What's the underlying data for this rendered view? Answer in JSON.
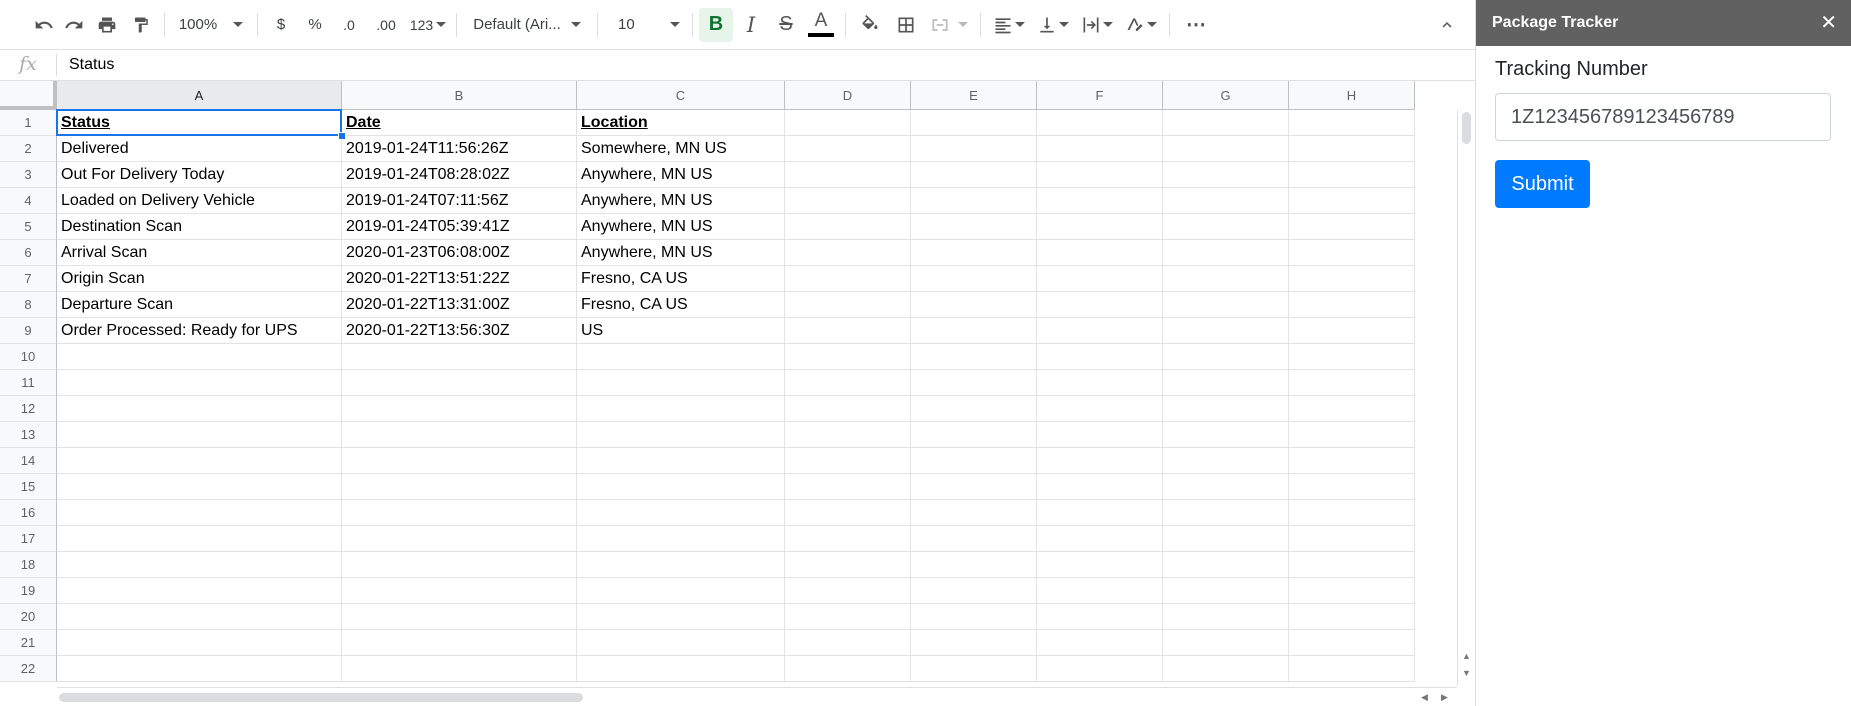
{
  "toolbar": {
    "zoom": "100%",
    "currency": "$",
    "percent": "%",
    "decrease_decimals": ".0",
    "increase_decimals": ".00",
    "more_formats": "123",
    "font": "Default (Ari...",
    "font_size": "10",
    "bold": "B",
    "italic": "I",
    "strike": "S",
    "text_color": "A",
    "more": "⋯"
  },
  "formula_bar": {
    "fx": "fx",
    "value": "Status"
  },
  "columns": [
    "A",
    "B",
    "C",
    "D",
    "E",
    "F",
    "G",
    "H"
  ],
  "rows": [
    "1",
    "2",
    "3",
    "4",
    "5",
    "6",
    "7",
    "8",
    "9",
    "10",
    "11",
    "12",
    "13",
    "14",
    "15",
    "16",
    "17",
    "18",
    "19",
    "20",
    "21",
    "22"
  ],
  "table": {
    "headers": [
      "Status",
      "Date",
      "Location"
    ],
    "rows": [
      [
        "Delivered",
        "2019-01-24T11:56:26Z",
        "Somewhere, MN US"
      ],
      [
        "Out For Delivery Today",
        "2019-01-24T08:28:02Z",
        "Anywhere, MN US"
      ],
      [
        "Loaded on Delivery Vehicle",
        "2019-01-24T07:11:56Z",
        "Anywhere, MN US"
      ],
      [
        "Destination Scan",
        "2019-01-24T05:39:41Z",
        "Anywhere, MN US"
      ],
      [
        "Arrival Scan",
        "2020-01-23T06:08:00Z",
        "Anywhere, MN US"
      ],
      [
        "Origin Scan",
        "2020-01-22T13:51:22Z",
        "Fresno, CA US"
      ],
      [
        "Departure Scan",
        "2020-01-22T13:31:00Z",
        "Fresno, CA US"
      ],
      [
        "Order Processed: Ready for UPS",
        "2020-01-22T13:56:30Z",
        "US"
      ]
    ]
  },
  "sidebar": {
    "title": "Package Tracker",
    "close": "✕",
    "tracking_label": "Tracking Number",
    "tracking_value": "1Z123456789123456789",
    "submit_label": "Submit"
  },
  "colors": {
    "sidebar_header": "#616161",
    "submit_button": "#007bff",
    "selection": "#1a73e8",
    "bold_active": "#e6f4ea"
  }
}
